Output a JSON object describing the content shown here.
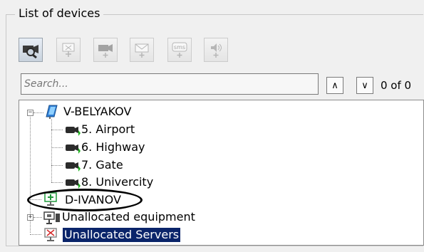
{
  "panel": {
    "title": "List of devices"
  },
  "toolbar": {
    "buttons": [
      {
        "name": "camera-search",
        "icon": "camera-magnifier-icon",
        "state": "active"
      },
      {
        "name": "add-server",
        "icon": "add-server-icon",
        "state": "disabled"
      },
      {
        "name": "add-camera",
        "icon": "add-camera-icon",
        "state": "disabled"
      },
      {
        "name": "add-email",
        "icon": "add-email-icon",
        "state": "disabled"
      },
      {
        "name": "add-sms",
        "icon": "add-sms-icon",
        "state": "disabled",
        "badge": "sms"
      },
      {
        "name": "add-sound",
        "icon": "add-sound-icon",
        "state": "disabled"
      }
    ],
    "plus_glyph": "+"
  },
  "search": {
    "placeholder": "Search...",
    "value": ""
  },
  "nav": {
    "up_glyph": "∧",
    "down_glyph": "∨",
    "counter": "0 of 0"
  },
  "tree": {
    "nodes": [
      {
        "label": "V-BELYAKOV",
        "icon": "server-blue-icon",
        "expander": "−"
      },
      {
        "label": "5. Airport",
        "icon": "camera-icon"
      },
      {
        "label": "6. Highway",
        "icon": "camera-icon"
      },
      {
        "label": "7. Gate",
        "icon": "camera-icon"
      },
      {
        "label": "8. Univercity",
        "icon": "camera-icon"
      },
      {
        "label": "D-IVANOV",
        "icon": "server-green-icon"
      },
      {
        "label": "Unallocated equipment",
        "icon": "equipment-icon",
        "expander": "+"
      },
      {
        "label": "Unallocated Servers",
        "icon": "server-red-icon",
        "selected": true
      }
    ]
  },
  "colors": {
    "selection": "#0a246a",
    "camera_status": "#1db41d",
    "server_blue": "#2f7fd6"
  }
}
